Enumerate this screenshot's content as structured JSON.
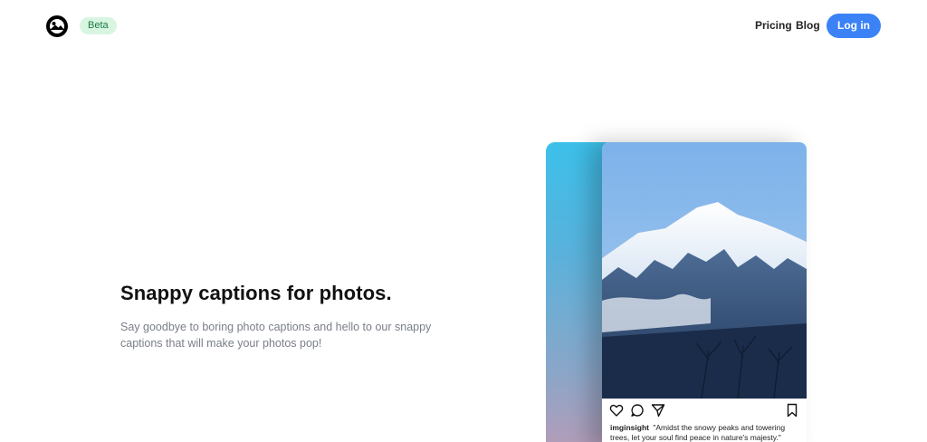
{
  "header": {
    "logo_icon": "mountain-photo-logo-icon",
    "badge": "Beta",
    "nav": {
      "pricing": "Pricing",
      "blog": "Blog"
    },
    "login_label": "Log in",
    "accent": "#3b82f6"
  },
  "hero": {
    "title": "Snappy captions for photos.",
    "subtitle": "Say goodbye to boring photo captions and hello to our snappy captions that will make your photos pop!"
  },
  "post": {
    "image_icon": "snowy-mountain-image",
    "icons": [
      "heart-icon",
      "comment-icon",
      "share-icon",
      "bookmark-icon"
    ],
    "username": "imginsight",
    "caption": "\"Amidst the snowy peaks and towering trees, let your soul find peace in nature's majesty.\""
  }
}
